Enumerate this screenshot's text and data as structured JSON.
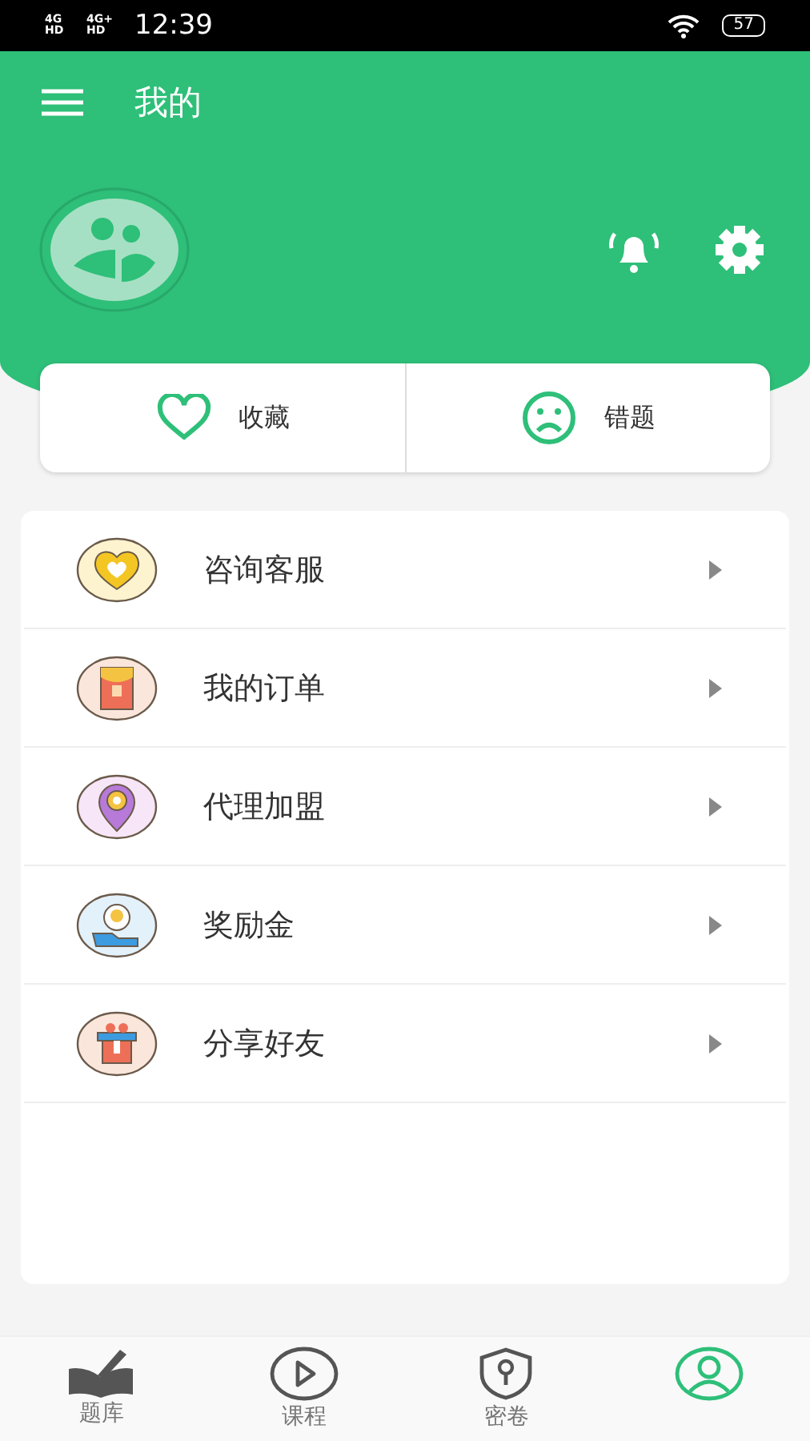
{
  "status_bar": {
    "networks": [
      "4G HD",
      "4G+ HD"
    ],
    "time": "12:39",
    "battery": "57"
  },
  "header": {
    "title": "我的"
  },
  "quick_actions": [
    {
      "kind": "heart",
      "label": "收藏"
    },
    {
      "kind": "sad",
      "label": "错题"
    }
  ],
  "menu": [
    {
      "kind": "heart",
      "label": "咨询客服"
    },
    {
      "kind": "envelope",
      "label": "我的订单"
    },
    {
      "kind": "pin",
      "label": "代理加盟"
    },
    {
      "kind": "coin",
      "label": "奖励金"
    },
    {
      "kind": "gift",
      "label": "分享好友"
    }
  ],
  "tabs": [
    {
      "kind": "book",
      "label": "题库",
      "selected": false
    },
    {
      "kind": "play",
      "label": "课程",
      "selected": false
    },
    {
      "kind": "shield",
      "label": "密卷",
      "selected": false
    },
    {
      "kind": "user",
      "selected": true
    }
  ]
}
